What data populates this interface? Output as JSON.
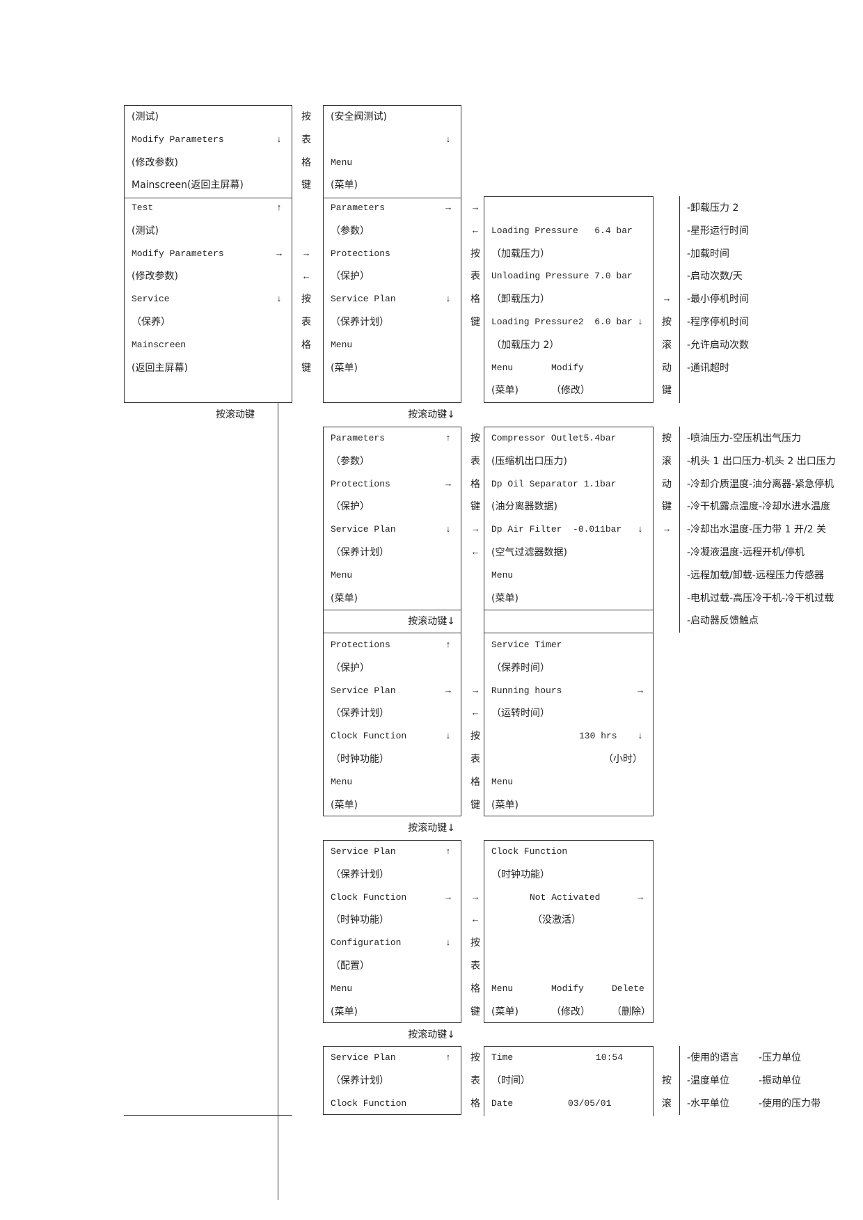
{
  "labels": {
    "scroll_key": "按滚动键",
    "scroll_key_down": "按滚动键↓"
  },
  "panels": {
    "test_upper": {
      "rows": [
        {
          "text": "(测试)"
        },
        {
          "text": "Modify Parameters",
          "arrow": "arrow-down"
        },
        {
          "text": "(修改参数)"
        },
        {
          "text": "Mainscreen(返回主屏幕)"
        }
      ]
    },
    "main_menu": {
      "rows": [
        {
          "text": "Test",
          "arrow": "arrow-up"
        },
        {
          "text": "(测试)"
        },
        {
          "text": "Modify Parameters",
          "arrow": "arrow-right"
        },
        {
          "text": "(修改参数)"
        },
        {
          "text": "Service",
          "arrow": "arrow-down"
        },
        {
          "text": "（保养）"
        },
        {
          "text": "Mainscreen"
        },
        {
          "text": "(返回主屏幕)"
        }
      ]
    },
    "safety_valve_test": {
      "rows": [
        {
          "text": "(安全阀测试)"
        },
        {
          "text": "",
          "arrow": "arrow-down"
        },
        {
          "text": "Menu"
        },
        {
          "text": "(菜单)"
        }
      ]
    },
    "modify_params": {
      "rows": [
        {
          "text": "Parameters",
          "arrow": "arrow-right"
        },
        {
          "text": "（参数）"
        },
        {
          "text": "Protections"
        },
        {
          "text": "（保护）"
        },
        {
          "text": "Service Plan",
          "arrow": "arrow-down"
        },
        {
          "text": "（保养计划）"
        },
        {
          "text": "Menu"
        },
        {
          "text": "(菜单)"
        }
      ]
    },
    "parameters_detail": {
      "rows": [
        {
          "text": ""
        },
        {
          "text": "Loading Pressure   6.4 bar"
        },
        {
          "text": "（加载压力）"
        },
        {
          "text": "Unloading Pressure 7.0 bar"
        },
        {
          "text": "（卸载压力）"
        },
        {
          "text": "Loading Pressure2  6.0 bar",
          "arrow": "arrow-down"
        },
        {
          "text": "（加载压力 2）"
        },
        {
          "cells": [
            "Menu",
            "Modify"
          ]
        },
        {
          "cells": [
            "(菜单)",
            "（修改）"
          ]
        }
      ]
    },
    "params_scroll": {
      "rows": [
        {
          "text": "Parameters",
          "arrow": "arrow-up"
        },
        {
          "text": "（参数）"
        },
        {
          "text": "Protections",
          "arrow": "arrow-right"
        },
        {
          "text": "（保护）"
        },
        {
          "text": "Service Plan",
          "arrow": "arrow-down"
        },
        {
          "text": "（保养计划）"
        },
        {
          "text": "Menu"
        },
        {
          "text": "(菜单)"
        }
      ]
    },
    "protections_values": {
      "rows": [
        {
          "text": "Compressor Outlet5.4bar"
        },
        {
          "text": "(压缩机出口压力)"
        },
        {
          "text": "Dp Oil Separator 1.1bar"
        },
        {
          "text": "(油分离器数据)"
        },
        {
          "text": "Dp Air Filter  -0.011bar",
          "arrow": "arrow-down"
        },
        {
          "text": "(空气过滤器数据)"
        },
        {
          "text": "Menu"
        },
        {
          "text": "(菜单)"
        }
      ]
    },
    "protections_menu": {
      "rows": [
        {
          "text": "Protections",
          "arrow": "arrow-up"
        },
        {
          "text": "（保护）"
        },
        {
          "text": "Service Plan",
          "arrow": "arrow-right"
        },
        {
          "text": "（保养计划）"
        },
        {
          "text": "Clock Function",
          "arrow": "arrow-down"
        },
        {
          "text": "（时钟功能）"
        },
        {
          "text": "Menu"
        },
        {
          "text": "(菜单)"
        }
      ]
    },
    "service_timer": {
      "rows": [
        {
          "text": "Service Timer"
        },
        {
          "text": "（保养时间）"
        },
        {
          "text": "Running hours",
          "arrow": "arrow-right"
        },
        {
          "text": "（运转时间）"
        },
        {
          "text": "130 hrs",
          "arrow": "arrow-down"
        },
        {
          "text": "（小时）"
        },
        {
          "text": "Menu"
        },
        {
          "text": "(菜单)"
        }
      ]
    },
    "service_plan_menu": {
      "rows": [
        {
          "text": "Service Plan",
          "arrow": "arrow-up"
        },
        {
          "text": "（保养计划）"
        },
        {
          "text": "Clock Function",
          "arrow": "arrow-right"
        },
        {
          "text": "（时钟功能）"
        },
        {
          "text": "Configuration",
          "arrow": "arrow-down"
        },
        {
          "text": "（配置）"
        },
        {
          "text": "Menu"
        },
        {
          "text": "(菜单)"
        }
      ]
    },
    "clock_function": {
      "rows": [
        {
          "text": "Clock Function"
        },
        {
          "text": "（时钟功能）"
        },
        {
          "text": "Not Activated",
          "arrow": "arrow-right"
        },
        {
          "text": "（没激活）"
        },
        {
          "text": ""
        },
        {
          "text": ""
        },
        {
          "cells": [
            "Menu",
            "Modify",
            "Delete"
          ]
        },
        {
          "cells": [
            "(菜单)",
            "（修改）",
            "（删除）"
          ]
        }
      ]
    },
    "clock_menu": {
      "rows": [
        {
          "text": "Service Plan",
          "arrow": "arrow-up"
        },
        {
          "text": "（保养计划）"
        },
        {
          "text": "Clock Function"
        }
      ]
    },
    "time_date": {
      "rows": [
        {
          "cells": [
            "Time",
            "10:54"
          ]
        },
        {
          "text": "（时间）"
        },
        {
          "cells": [
            "Date",
            "03/05/01"
          ]
        }
      ]
    }
  },
  "connectors": {
    "k_top1": [
      "按",
      "表",
      "格",
      "键"
    ],
    "k_main1": [
      "",
      "",
      "→",
      "←",
      "按",
      "表",
      "格",
      "键"
    ],
    "k_main2": [
      "→",
      "←",
      "按",
      "表",
      "格",
      "键"
    ],
    "k_main3": [
      "",
      "",
      "",
      "",
      "→",
      "按",
      "滚",
      "动",
      "键"
    ],
    "k_c2": [
      "按",
      "表",
      "格",
      "键",
      "→",
      "←"
    ],
    "k_c3": [
      "按",
      "滚",
      "动",
      "键",
      "→"
    ],
    "k_d2": [
      "",
      "",
      "→",
      "←",
      "按",
      "表",
      "格",
      "键"
    ],
    "k_e2": [
      "",
      "",
      "→",
      "←",
      "按",
      "表",
      "格",
      "键"
    ],
    "k_f2": [
      "按",
      "表",
      "格"
    ],
    "k_f3": [
      "",
      "按",
      "滚"
    ]
  },
  "lists": {
    "parameters_list": [
      "-卸载压力 2",
      "-星形运行时间",
      "-加载时间",
      "-启动次数/天",
      "-最小停机时间",
      "-程序停机时间",
      "-允许启动次数",
      "-通讯超时"
    ],
    "protections_list": [
      "-喷油压力-空压机出气压力",
      "-机头 1 出口压力-机头 2 出口压力",
      "-冷却介质温度-油分离器-紧急停机",
      "-冷干机露点温度-冷却水进水温度",
      "-冷却出水温度-压力带 1 开/2 关",
      "-冷凝液温度-远程开机/停机",
      "-远程加载/卸载-远程压力传感器",
      "-电机过载-高压冷干机-冷干机过载",
      "-启动器反馈触点"
    ],
    "config_list": [
      [
        "-使用的语言",
        "-压力单位"
      ],
      [
        "-温度单位",
        "-振动单位"
      ],
      [
        "-水平单位",
        "-使用的压力带"
      ]
    ]
  }
}
